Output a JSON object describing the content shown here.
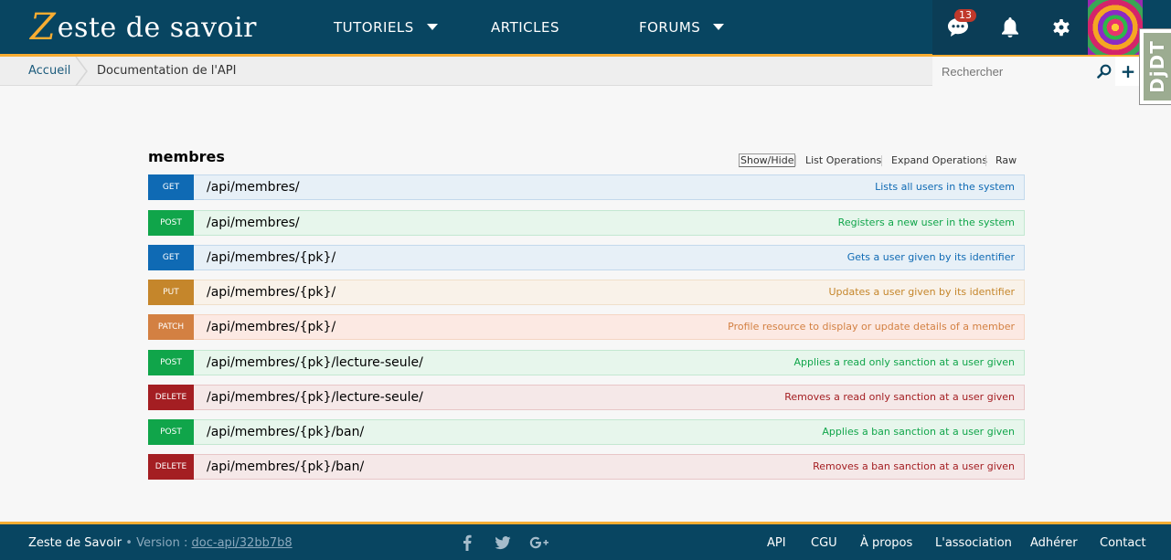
{
  "header": {
    "logo": {
      "mark": "Z",
      "text": "este de savoir"
    },
    "nav": [
      {
        "label": "TUTORIELS"
      },
      {
        "label": "ARTICLES"
      },
      {
        "label": "FORUMS"
      }
    ],
    "notification_count": "13",
    "icons": [
      "messages-icon",
      "bell-icon",
      "gear-icon"
    ],
    "accent_color": "#f8ad32",
    "brand_color": "#084561"
  },
  "breadcrumb": {
    "home": "Accueil",
    "current": "Documentation de l'API"
  },
  "search": {
    "placeholder": "Rechercher"
  },
  "debug_toolbar": {
    "label": "DjDT"
  },
  "api": {
    "section_title": "membres",
    "operations_links": [
      "Show/Hide",
      "List Operations",
      "Expand Operations",
      "Raw"
    ],
    "endpoints": [
      {
        "method": "GET",
        "path": "/api/membres/",
        "description": "Lists all users in the system"
      },
      {
        "method": "POST",
        "path": "/api/membres/",
        "description": "Registers a new user in the system"
      },
      {
        "method": "GET",
        "path": "/api/membres/{pk}/",
        "description": "Gets a user given by its identifier"
      },
      {
        "method": "PUT",
        "path": "/api/membres/{pk}/",
        "description": "Updates a user given by its identifier"
      },
      {
        "method": "PATCH",
        "path": "/api/membres/{pk}/",
        "description": "Profile resource to display or update details of a member"
      },
      {
        "method": "POST",
        "path": "/api/membres/{pk}/lecture-seule/",
        "description": "Applies a read only sanction at a user given"
      },
      {
        "method": "DELETE",
        "path": "/api/membres/{pk}/lecture-seule/",
        "description": "Removes a read only sanction at a user given"
      },
      {
        "method": "POST",
        "path": "/api/membres/{pk}/ban/",
        "description": "Applies a ban sanction at a user given"
      },
      {
        "method": "DELETE",
        "path": "/api/membres/{pk}/ban/",
        "description": "Removes a ban sanction at a user given"
      }
    ]
  },
  "footer": {
    "site_name": "Zeste de Savoir",
    "version_label": "Version :",
    "version_value": "doc-api/32bb7b8",
    "social": [
      "facebook-icon",
      "twitter-icon",
      "google-plus-icon"
    ],
    "links": [
      "API",
      "CGU",
      "À propos",
      "L'association",
      "Adhérer",
      "Contact"
    ]
  }
}
